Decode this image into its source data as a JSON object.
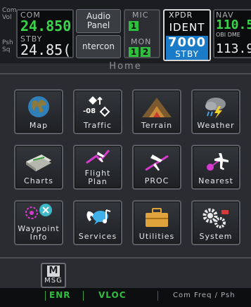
{
  "colors": {
    "accent_green": "#39d64a",
    "xpdr_blue": "#1a7cc9",
    "background": "#2a2c31"
  },
  "left_labels": {
    "line1": "Com",
    "line2": "Vol",
    "line3": "Psh",
    "line4": "Sq"
  },
  "com": {
    "label": "COM",
    "active": "24.850",
    "stby_label": "STBY",
    "standby": "24.85("
  },
  "audio": {
    "line1": "Audio",
    "line2": "Panel",
    "intercom": "ntercon"
  },
  "mic": {
    "label": "MIC",
    "value": "1",
    "mon_label": "MON",
    "mon_1": "1",
    "mon_2": "2"
  },
  "xpdr": {
    "label": "XPDR",
    "ident": "IDENT",
    "code": "7000",
    "mode": "STBY"
  },
  "nav": {
    "label": "NAV",
    "active": "110.5",
    "obi": "OBI DME",
    "standby": "113.9"
  },
  "page_title": "Home",
  "tiles": [
    {
      "label": "Map",
      "icon": "globe-icon"
    },
    {
      "label": "Traffic",
      "icon": "traffic-icon",
      "value": "-08"
    },
    {
      "label": "Terrain",
      "icon": "mountain-icon"
    },
    {
      "label": "Weather",
      "icon": "storm-cloud-icon"
    },
    {
      "label": "Charts",
      "icon": "charts-icon"
    },
    {
      "label": "Flight",
      "label2": "Plan",
      "icon": "flight-plan-icon"
    },
    {
      "label": "PROC",
      "icon": "procedure-icon"
    },
    {
      "label": "Nearest",
      "icon": "nearest-icon"
    },
    {
      "label": "Waypoint",
      "label2": "Info",
      "icon": "waypoint-icon"
    },
    {
      "label": "Services",
      "icon": "services-icon"
    },
    {
      "label": "Utilities",
      "icon": "toolbox-icon"
    },
    {
      "label": "System",
      "icon": "gears-icon"
    }
  ],
  "msg": {
    "letter": "M",
    "label": "MSG"
  },
  "status": {
    "enr": "ENR",
    "vloc": "VLOC",
    "hint": "Com Freq / Psh"
  }
}
